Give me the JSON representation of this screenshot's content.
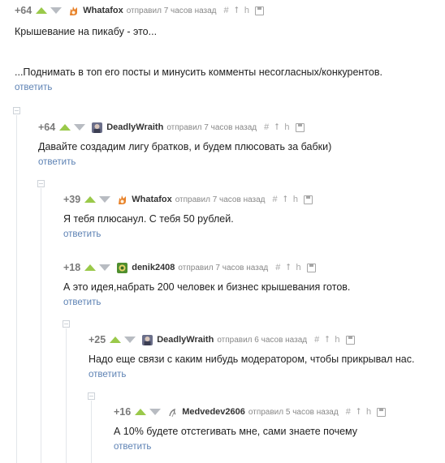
{
  "colors": {
    "upvote": "#9ac94a",
    "downvote": "#b8bcc2",
    "reply_link": "#5d82b4",
    "meta_text": "#888888"
  },
  "icons": {
    "link": "hash-icon",
    "parent": "up-arrow-icon",
    "branch": "branch-icon",
    "save": "save-icon"
  },
  "comments": [
    {
      "rating": "+64",
      "author": "Whatafox",
      "avatar": "fox-avatar",
      "time": "отправил 7 часов назад",
      "lines": [
        "Крышевание на пикабу - это...",
        "",
        "...Поднимать в топ его посты и минусить комменты несогласных/конкурентов."
      ],
      "reply": "ответить"
    },
    {
      "rating": "+64",
      "author": "DeadlyWraith",
      "avatar": "wraith-avatar",
      "time": "отправил 7 часов назад",
      "lines": [
        "Давайте создадим лигу братков, и будем плюсовать за бабки)"
      ],
      "reply": "ответить"
    },
    {
      "rating": "+39",
      "author": "Whatafox",
      "avatar": "fox-avatar",
      "time": "отправил 7 часов назад",
      "lines": [
        "Я тебя плюсанул. С тебя 50 рублей."
      ],
      "reply": "ответить"
    },
    {
      "rating": "+18",
      "author": "denik2408",
      "avatar": "denik-avatar",
      "time": "отправил 7 часов назад",
      "lines": [
        "А это идея,набрать 200 человек и бизнес крышевания готов."
      ],
      "reply": "ответить"
    },
    {
      "rating": "+25",
      "author": "DeadlyWraith",
      "avatar": "wraith-avatar",
      "time": "отправил 6 часов назад",
      "lines": [
        "Надо еще связи с каким нибудь модератором, чтобы прикрывал нас."
      ],
      "reply": "ответить"
    },
    {
      "rating": "+16",
      "author": "Medvedev2606",
      "avatar": "medvedev-avatar",
      "time": "отправил 5 часов назад",
      "lines": [
        "А 10% будете отстегивать мне, сами знаете почему"
      ],
      "reply": "ответить"
    }
  ]
}
